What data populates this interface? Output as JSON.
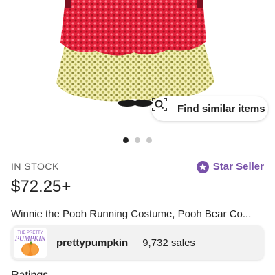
{
  "product_image": {
    "alt": "Winnie the Pooh Running Costume",
    "carousel": {
      "total": 3,
      "active": 1
    }
  },
  "find_similar": {
    "label": "Find similar items",
    "icon": "visual-search-icon"
  },
  "stock_status": "IN STOCK",
  "star_seller": {
    "label": "Star Seller",
    "icon": "star-badge-icon",
    "color": "#7851a9"
  },
  "price": "$72.25+",
  "listing_title": "Winnie the Pooh Running Costume, Pooh Bear Co...",
  "shop": {
    "name": "prettypumpkin",
    "sales": "9,732 sales",
    "logo_text_top": "THE PRETTY",
    "logo_text_main": "PUMPKIN"
  },
  "next_section_label": "Ratings"
}
